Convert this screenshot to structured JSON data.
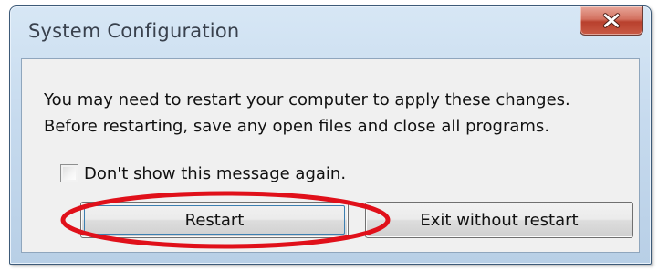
{
  "window": {
    "title": "System Configuration",
    "close_icon": "close-x-icon"
  },
  "dialog": {
    "message_line1": "You may need to restart your computer to apply these changes.",
    "message_line2": "Before restarting, save any open files and close all programs.",
    "checkbox_label": "Don't show this message again.",
    "checkbox_checked": false,
    "restart_label": "Restart",
    "exit_label": "Exit without restart"
  },
  "annotation": {
    "shape": "ellipse",
    "target": "restart-button",
    "color": "#e0101a"
  }
}
